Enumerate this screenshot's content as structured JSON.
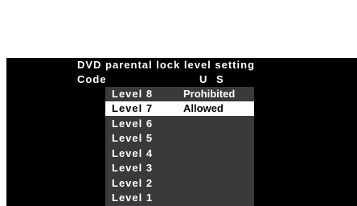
{
  "screen": {
    "title": "DVD parental lock level setting",
    "code_label": "Code",
    "code_value": "U S"
  },
  "menu": {
    "items": [
      {
        "level": "Level 8",
        "state": "Prohibited",
        "selected": false
      },
      {
        "level": "Level 7",
        "state": "Allowed",
        "selected": true
      },
      {
        "level": "Level 6",
        "state": "",
        "selected": false
      },
      {
        "level": "Level 5",
        "state": "",
        "selected": false
      },
      {
        "level": "Level 4",
        "state": "",
        "selected": false
      },
      {
        "level": "Level 3",
        "state": "",
        "selected": false
      },
      {
        "level": "Level 2",
        "state": "",
        "selected": false
      },
      {
        "level": "Level 1",
        "state": "",
        "selected": false
      }
    ]
  },
  "colors": {
    "background": "#000000",
    "menu_background": "#3a3a3a",
    "selection": "#ffffff",
    "text": "#ffffff"
  }
}
